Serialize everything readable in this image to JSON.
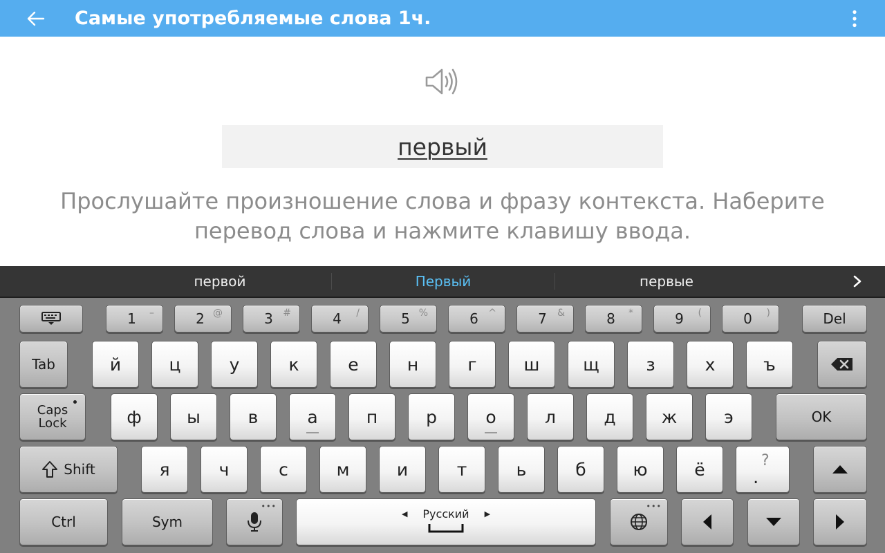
{
  "app_bar": {
    "title": "Самые употребляемые слова 1ч.",
    "back_icon": "arrow-left-icon",
    "menu_icon": "more-vertical-icon",
    "color": "#55adef"
  },
  "exercise": {
    "speaker_icon": "speaker-icon",
    "word": "первый",
    "instructions": "Прослушайте произношение слова и фразу контекста. Наберите перевод слова и нажмите клавишу ввода."
  },
  "suggestions": {
    "items": [
      "первой",
      "Первый",
      "первые"
    ],
    "active_index": 1,
    "active_color": "#5ac0f5"
  },
  "keyboard": {
    "hide_keyboard_icon": "keyboard-hide-icon",
    "number_row": [
      {
        "digit": "1",
        "alt": "–"
      },
      {
        "digit": "2",
        "alt": "@"
      },
      {
        "digit": "3",
        "alt": "#"
      },
      {
        "digit": "4",
        "alt": "/"
      },
      {
        "digit": "5",
        "alt": "%"
      },
      {
        "digit": "6",
        "alt": "^"
      },
      {
        "digit": "7",
        "alt": "&"
      },
      {
        "digit": "8",
        "alt": "*"
      },
      {
        "digit": "9",
        "alt": "("
      },
      {
        "digit": "0",
        "alt": ")"
      }
    ],
    "del_label": "Del",
    "tab_label": "Tab",
    "row1": [
      "й",
      "ц",
      "у",
      "к",
      "е",
      "н",
      "г",
      "ш",
      "щ",
      "з",
      "х",
      "ъ"
    ],
    "backspace_icon": "backspace-icon",
    "caps_label_1": "Caps",
    "caps_label_2": "Lock",
    "row2": [
      "ф",
      "ы",
      "в",
      "а",
      "п",
      "р",
      "о",
      "л",
      "д",
      "ж",
      "э"
    ],
    "ok_label": "OK",
    "shift_label": "Shift",
    "shift_icon": "shift-arrow-icon",
    "row3": [
      "я",
      "ч",
      "с",
      "м",
      "и",
      "т",
      "ь",
      "б",
      "ю",
      "ё"
    ],
    "punct_main": ".",
    "punct_alt": "?",
    "ctrl_label": "Ctrl",
    "sym_label": "Sym",
    "mic_icon": "microphone-icon",
    "space_label": "Русский",
    "globe_icon": "globe-icon",
    "arrow_up_icon": "arrow-up-icon",
    "arrow_left_icon": "arrow-left-icon",
    "arrow_down_icon": "arrow-down-icon",
    "arrow_right_icon": "arrow-right-icon"
  }
}
